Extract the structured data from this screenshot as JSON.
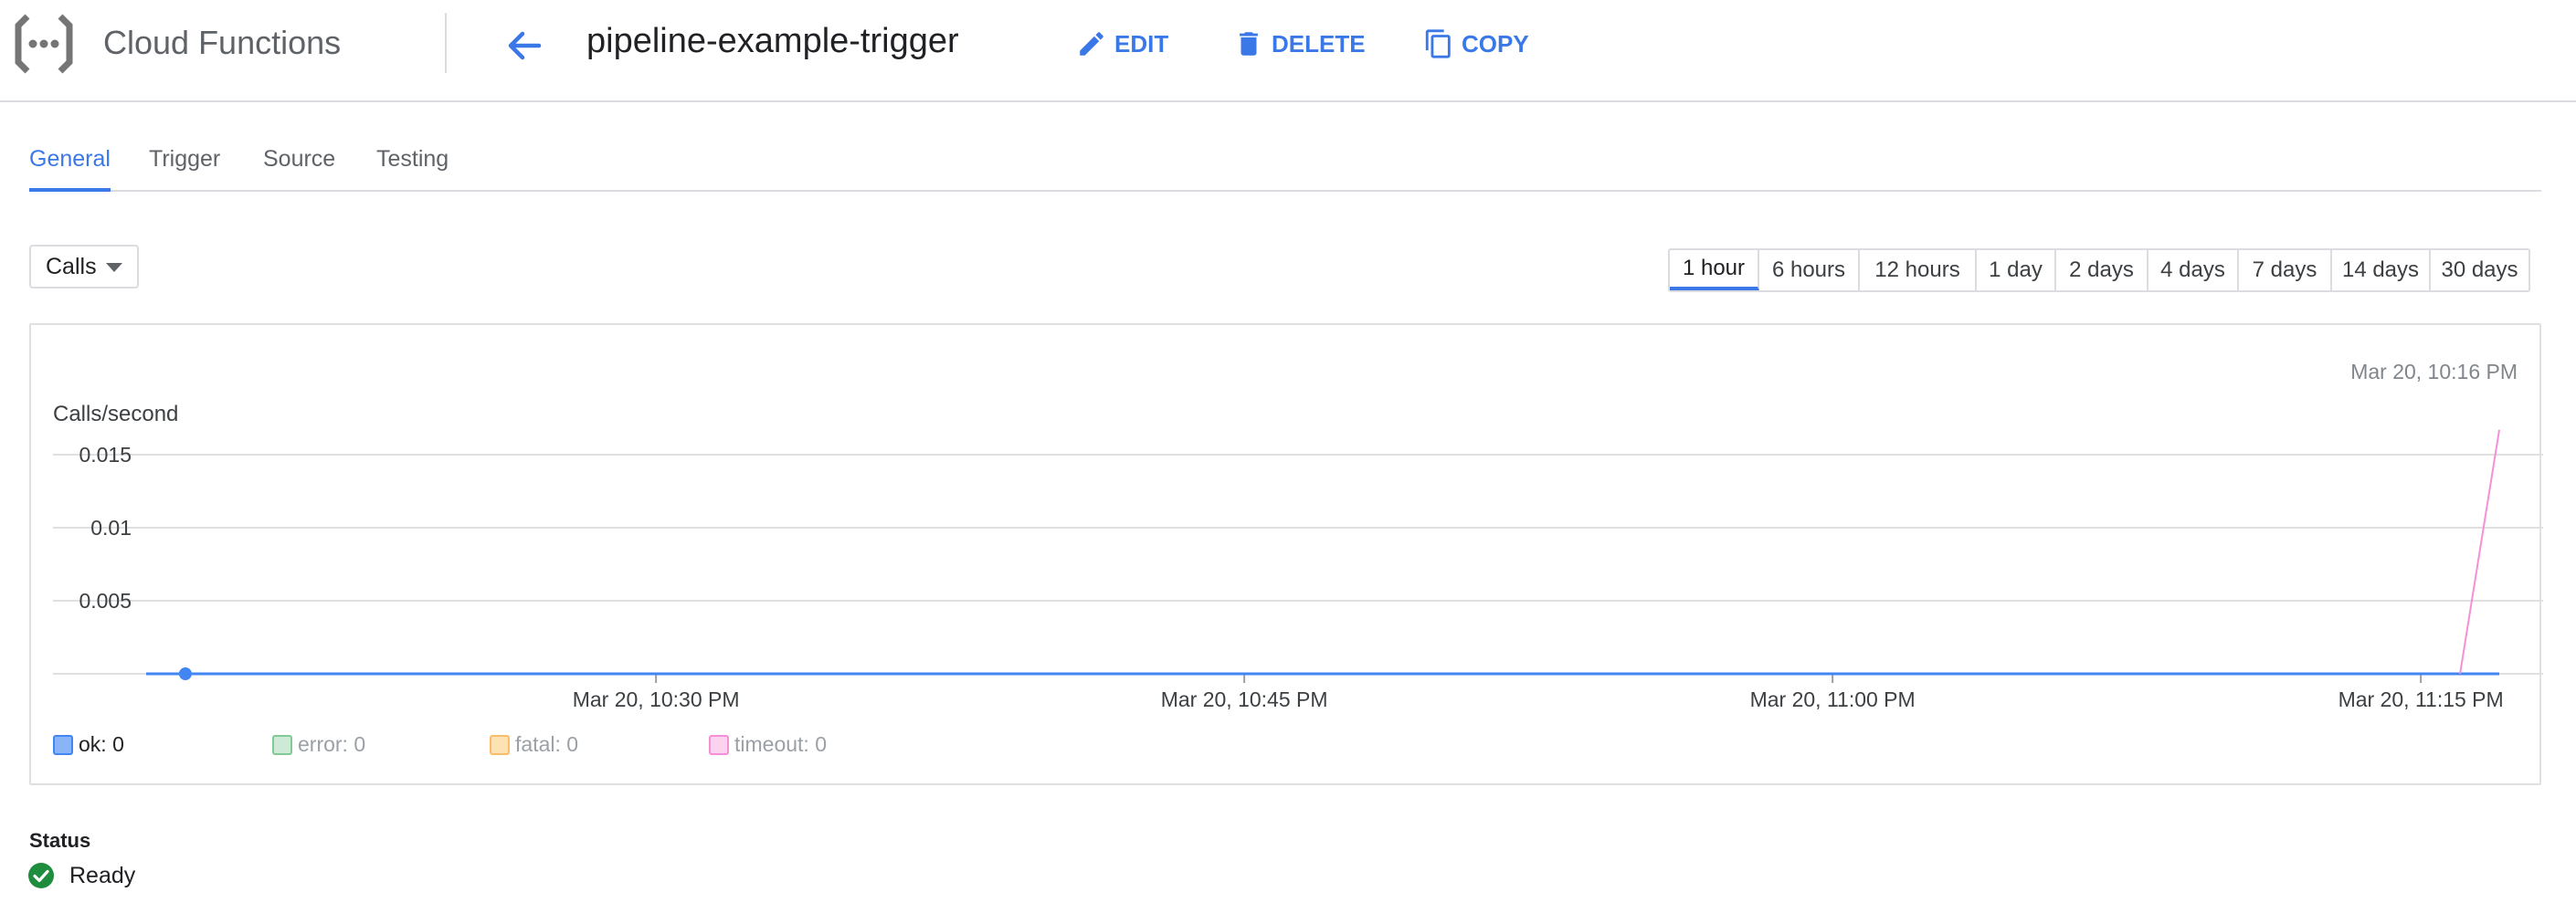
{
  "header": {
    "app_title": "Cloud Functions",
    "function_name": "pipeline-example-trigger",
    "actions": {
      "edit": "EDIT",
      "delete": "DELETE",
      "copy": "COPY"
    }
  },
  "tabs": [
    {
      "label": "General",
      "active": true
    },
    {
      "label": "Trigger",
      "active": false
    },
    {
      "label": "Source",
      "active": false
    },
    {
      "label": "Testing",
      "active": false
    }
  ],
  "metric_select": {
    "value": "Calls"
  },
  "time_ranges": [
    {
      "label": "1 hour",
      "active": true
    },
    {
      "label": "6 hours",
      "active": false
    },
    {
      "label": "12 hours",
      "active": false
    },
    {
      "label": "1 day",
      "active": false
    },
    {
      "label": "2 days",
      "active": false
    },
    {
      "label": "4 days",
      "active": false
    },
    {
      "label": "7 days",
      "active": false
    },
    {
      "label": "14 days",
      "active": false
    },
    {
      "label": "30 days",
      "active": false
    }
  ],
  "colors": {
    "accent": "#3b78e7",
    "ok": "#4285f4",
    "error": "#81c995",
    "fatal": "#fbbc6a",
    "timeout": "#f48fd8",
    "ready": "#1e8e3e"
  },
  "chart_data": {
    "type": "line",
    "timestamp": "Mar 20, 10:16 PM",
    "ylabel": "Calls/second",
    "ylim": [
      0,
      0.015
    ],
    "yticks": [
      0.015,
      0.01,
      0.005
    ],
    "ytick_labels": [
      "0.015",
      "0.01",
      "0.005"
    ],
    "xlim": [
      "22:17",
      "23:17"
    ],
    "xticks": [
      "22:30",
      "22:45",
      "23:00",
      "23:15"
    ],
    "xtick_labels": [
      "Mar 20, 10:30 PM",
      "Mar 20, 10:45 PM",
      "Mar 20, 11:00 PM",
      "Mar 20, 11:15 PM"
    ],
    "series": [
      {
        "name": "ok",
        "legend": "ok: 0",
        "x": [
          "22:17",
          "22:18",
          "23:17"
        ],
        "values": [
          0,
          0,
          0
        ],
        "marker_at": "22:18"
      },
      {
        "name": "error",
        "legend": "error: 0",
        "x": [],
        "values": []
      },
      {
        "name": "fatal",
        "legend": "fatal: 0",
        "x": [],
        "values": []
      },
      {
        "name": "timeout",
        "legend": "timeout: 0",
        "x": [
          "23:16",
          "23:17"
        ],
        "values": [
          0,
          0.0167
        ]
      }
    ]
  },
  "status": {
    "label": "Status",
    "value": "Ready"
  }
}
